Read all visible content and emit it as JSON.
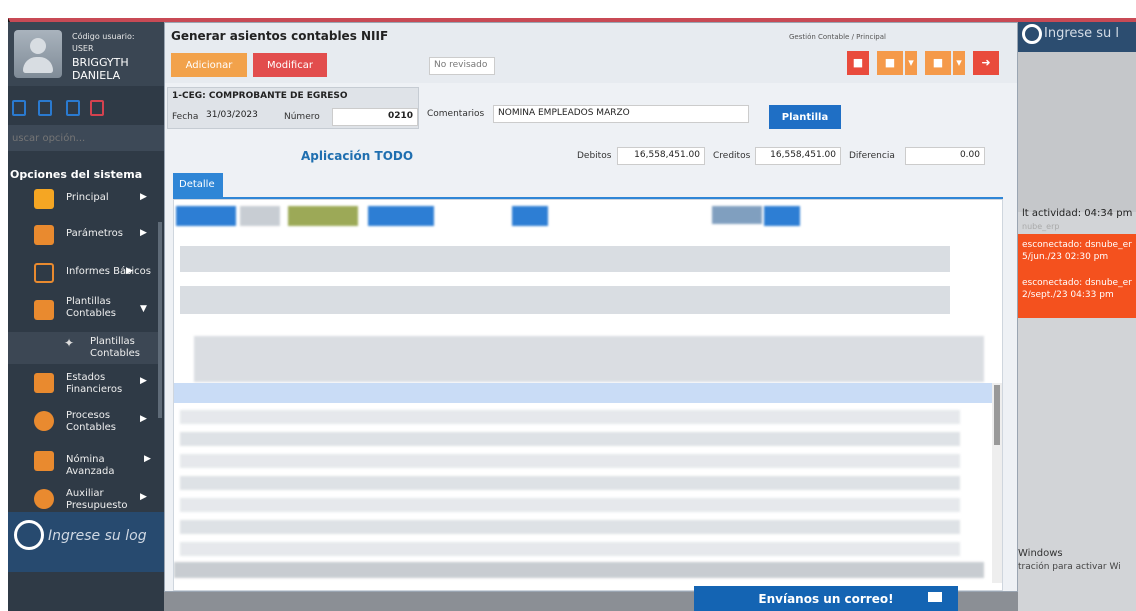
{
  "sidebar": {
    "user_label": "Código usuario:",
    "user_role": "USER",
    "user_name": "BRIGGYTH DANIELA",
    "search_placeholder": "uscar opción...",
    "system_options_title": "Opciones del sistema",
    "menu": [
      {
        "label": "Principal"
      },
      {
        "label": "Parámetros"
      },
      {
        "label": "Informes Básicos"
      },
      {
        "label": "Plantillas Contables"
      },
      {
        "label": "Plantillas Contables"
      },
      {
        "label": "Estados Financieros"
      },
      {
        "label": "Procesos Contables"
      },
      {
        "label": "Nómina Avanzada"
      },
      {
        "label": "Auxiliar Presupuesto"
      }
    ],
    "login_banner": "Ingrese su log"
  },
  "modal": {
    "title": "Generar asientos contables NIIF",
    "breadcrumb": "Gestión Contable / Principal",
    "add_label": "Adicionar",
    "modify_label": "Modificar",
    "status": "No revisado",
    "doc_code": "1-CEG: COMPROBANTE DE EGRESO",
    "fecha_label": "Fecha",
    "fecha_value": "31/03/2023",
    "numero_label": "Número",
    "numero_value": "0210",
    "comentarios_label": "Comentarios",
    "comentarios_value": "NOMINA EMPLEADOS MARZO",
    "plantilla_label": "Plantilla",
    "aplicacion": "Aplicación TODO",
    "debitos_label": "Debitos",
    "debitos_value": "16,558,451.00",
    "creditos_label": "Creditos",
    "creditos_value": "16,558,451.00",
    "diferencia_label": "Diferencia",
    "diferencia_value": "0.00",
    "tab_detalle": "Detalle"
  },
  "right_panel": {
    "login_banner": "Ingrese su l",
    "activity": "lt actividad: 04:34 pm",
    "activity_sub": "nube_erp",
    "disconnect_1a": "esconectado: dsnube_er",
    "disconnect_1b": "5/jun./23 02:30 pm",
    "disconnect_2a": "esconectado: dsnube_er",
    "disconnect_2b": "2/sept./23 04:33 pm",
    "windows_1": "Windows",
    "windows_2": "tración para activar Wi"
  },
  "footer": {
    "email_label": "Envíanos un correo!"
  },
  "colors": {
    "sidebar_bg": "#2f3a46",
    "accent_blue": "#1f6fc5",
    "add_button": "#f2a24b",
    "modify_button": "#e24d4d",
    "alert_orange": "#f4511e"
  }
}
